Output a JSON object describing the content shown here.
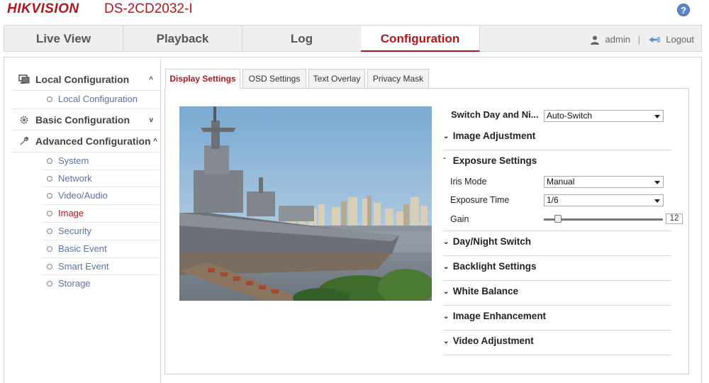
{
  "header": {
    "logo": "HIKVISION",
    "model": "DS-2CD2032-I",
    "help_label": "?"
  },
  "nav": {
    "tabs": [
      {
        "label": "Live View"
      },
      {
        "label": "Playback"
      },
      {
        "label": "Log"
      },
      {
        "label": "Configuration"
      }
    ],
    "active_tab": "Configuration",
    "user": "admin",
    "separator": "|",
    "logout": "Logout"
  },
  "sidebar": {
    "groups": [
      {
        "label": "Local Configuration",
        "chevron": "^",
        "icon": "monitor-icon",
        "items": [
          {
            "label": "Local Configuration"
          }
        ]
      },
      {
        "label": "Basic Configuration",
        "chevron": "v",
        "icon": "gear-icon",
        "items": []
      },
      {
        "label": "Advanced Configuration",
        "chevron": "^",
        "icon": "wrench-icon",
        "items": [
          {
            "label": "System"
          },
          {
            "label": "Network"
          },
          {
            "label": "Video/Audio"
          },
          {
            "label": "Image"
          },
          {
            "label": "Security"
          },
          {
            "label": "Basic Event"
          },
          {
            "label": "Smart Event"
          },
          {
            "label": "Storage"
          }
        ]
      }
    ],
    "active_item": "Image"
  },
  "subtabs": [
    {
      "label": "Display Settings"
    },
    {
      "label": "OSD Settings"
    },
    {
      "label": "Text Overlay"
    },
    {
      "label": "Privacy Mask"
    }
  ],
  "active_subtab": "Display Settings",
  "settings": {
    "switch_day_night": {
      "label": "Switch Day and Ni...",
      "value": "Auto-Switch"
    },
    "image_adjustment": "Image Adjustment",
    "exposure_settings": "Exposure Settings",
    "iris_mode": {
      "label": "Iris Mode",
      "value": "Manual"
    },
    "exposure_time": {
      "label": "Exposure Time",
      "value": "1/6"
    },
    "gain": {
      "label": "Gain",
      "value": "12",
      "max": 100
    },
    "day_night_switch": "Day/Night Switch",
    "backlight_settings": "Backlight Settings",
    "white_balance": "White Balance",
    "image_enhancement": "Image Enhancement",
    "video_adjustment": "Video Adjustment"
  },
  "colors": {
    "brand": "#b4141c",
    "link": "#5a73a8"
  }
}
